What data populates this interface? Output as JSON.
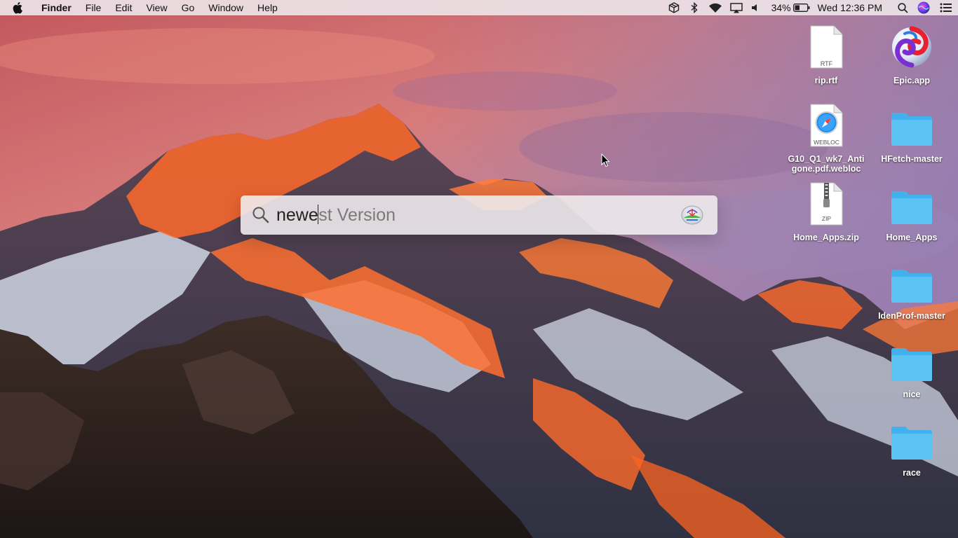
{
  "menubar": {
    "app_name": "Finder",
    "menus": [
      "File",
      "Edit",
      "View",
      "Go",
      "Window",
      "Help"
    ],
    "battery_percent": "34%",
    "clock": "Wed 12:36 PM",
    "status_icons": [
      "package-icon",
      "bluetooth-icon",
      "wifi-icon",
      "airplay-icon",
      "volume-icon",
      "battery-icon",
      "spotlight-search-icon",
      "siri-icon",
      "notification-center-icon"
    ]
  },
  "spotlight": {
    "typed": "newe",
    "completion": "st Version"
  },
  "desktop": {
    "items": [
      {
        "label": "rip.rtf",
        "type": "rtf-file",
        "badge": "RTF"
      },
      {
        "label": "Epic.app",
        "type": "app"
      },
      {
        "label": "G10_Q1_wk7_Antigone.pdf.webloc",
        "type": "webloc-file",
        "badge": "WEBLOC"
      },
      {
        "label": "HFetch-master",
        "type": "folder"
      },
      {
        "label": "Home_Apps.zip",
        "type": "zip-file",
        "badge": "ZIP"
      },
      {
        "label": "Home_Apps",
        "type": "folder"
      },
      {
        "label": "IdenProf-master",
        "type": "folder"
      },
      {
        "label": "nice",
        "type": "folder"
      },
      {
        "label": "race",
        "type": "folder"
      }
    ]
  },
  "colors": {
    "folder": "#5cc3f5",
    "sky_top": "#c85f63",
    "sky_mid": "#b87b9c",
    "rock_orange": "#ff6a2a"
  }
}
